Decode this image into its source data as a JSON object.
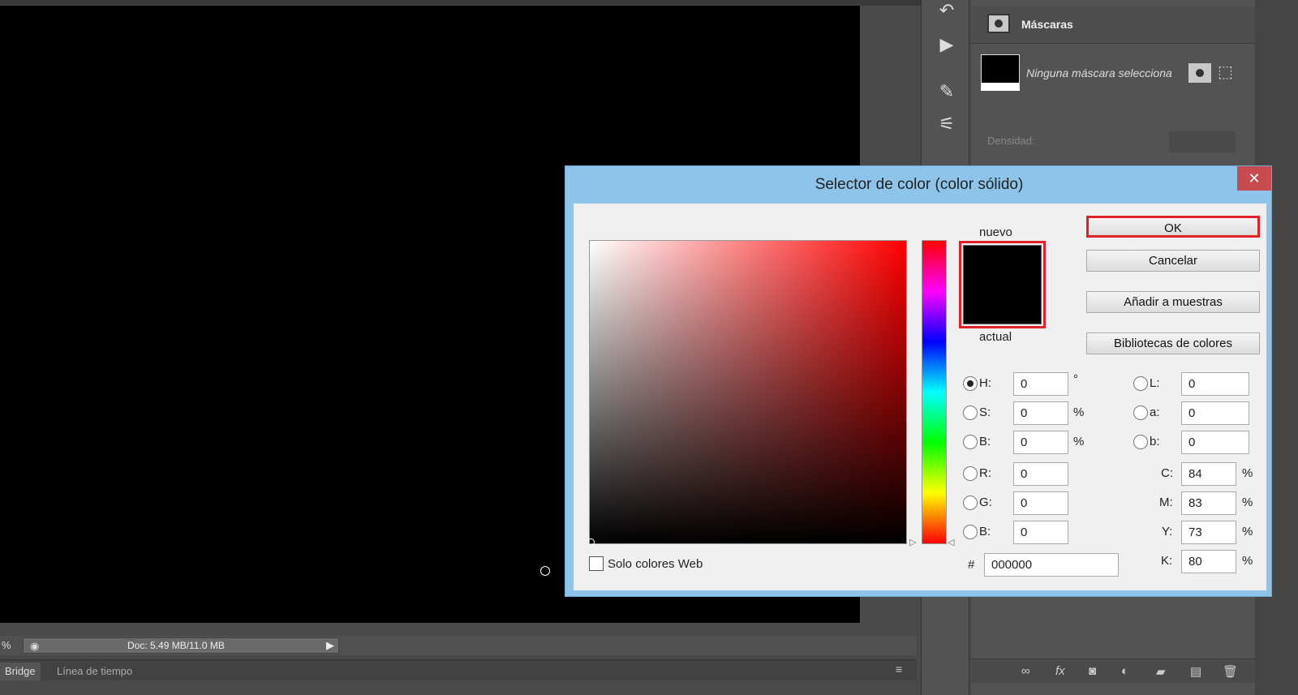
{
  "status": {
    "zoom_fragment": "%",
    "doc": "Doc: 5.49 MB/11.0 MB"
  },
  "bottom_tabs": [
    "Bridge",
    "Línea de tiempo"
  ],
  "panel": {
    "title": "Máscaras",
    "no_mask": "Ninguna máscara selecciona",
    "density_label": "Densidad:"
  },
  "dialog": {
    "title": "Selector de color (color sólido)",
    "nuevo": "nuevo",
    "actual": "actual",
    "new_color": "#000000",
    "current_color": "#000000",
    "buttons": {
      "ok": "OK",
      "cancel": "Cancelar",
      "add": "Añadir a muestras",
      "libraries": "Bibliotecas de colores"
    },
    "web_only": "Solo colores Web",
    "hsb": [
      {
        "label": "H:",
        "value": "0",
        "unit": "°",
        "selected": true
      },
      {
        "label": "S:",
        "value": "0",
        "unit": "%",
        "selected": false
      },
      {
        "label": "B:",
        "value": "0",
        "unit": "%",
        "selected": false
      }
    ],
    "rgb": [
      {
        "label": "R:",
        "value": "0"
      },
      {
        "label": "G:",
        "value": "0"
      },
      {
        "label": "B:",
        "value": "0"
      }
    ],
    "lab": [
      {
        "label": "L:",
        "value": "0"
      },
      {
        "label": "a:",
        "value": "0"
      },
      {
        "label": "b:",
        "value": "0"
      }
    ],
    "cmyk": [
      {
        "label": "C:",
        "value": "84",
        "unit": "%"
      },
      {
        "label": "M:",
        "value": "83",
        "unit": "%"
      },
      {
        "label": "Y:",
        "value": "73",
        "unit": "%"
      },
      {
        "label": "K:",
        "value": "80",
        "unit": "%"
      }
    ],
    "hex_label": "#",
    "hex": "000000",
    "highlight_color": "#e0202a"
  }
}
